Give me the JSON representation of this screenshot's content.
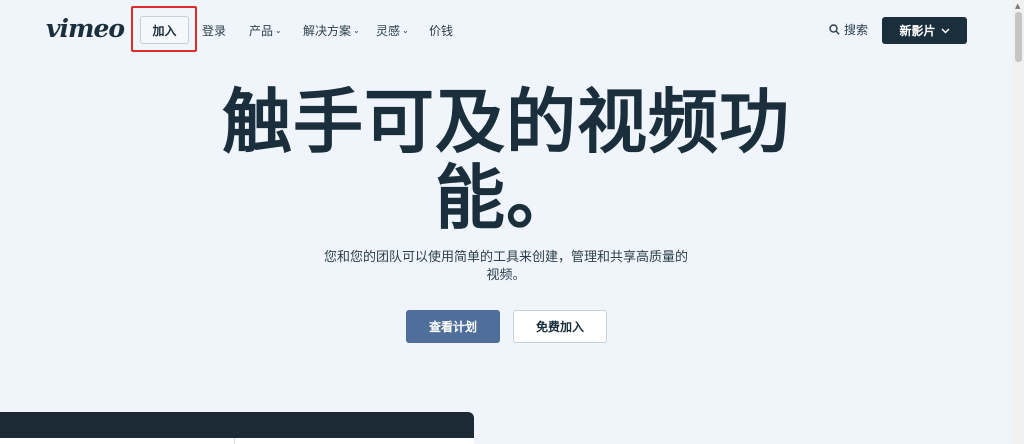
{
  "header": {
    "logo": "vimeo",
    "join_label": "加入",
    "login_label": "登录",
    "nav": [
      {
        "label": "产品",
        "has_dropdown": true
      },
      {
        "label": "解决方案",
        "has_dropdown": true
      },
      {
        "label": "灵感",
        "has_dropdown": true
      },
      {
        "label": "价钱",
        "has_dropdown": false
      }
    ],
    "search_label": "搜索",
    "new_video_label": "新影片"
  },
  "hero": {
    "title": "触手可及的视频功能。",
    "subtitle": "您和您的团队可以使用简单的工具来创建，管理和共享高质量的视频。",
    "primary_button": "查看计划",
    "secondary_button": "免费加入"
  },
  "colors": {
    "background": "#eff5fb",
    "dark": "#1a2e3b",
    "primary_button": "#4f6f9a",
    "highlight": "#e02b2b"
  }
}
